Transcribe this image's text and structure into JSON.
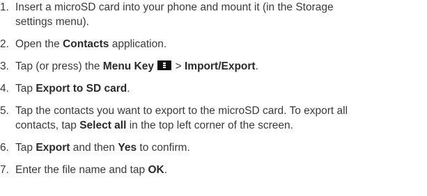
{
  "steps": [
    {
      "num": "1.",
      "line1": "Insert a microSD card into your phone and mount it (in the Storage",
      "line2": "settings menu)."
    },
    {
      "num": "2.",
      "pre": "Open the ",
      "bold": "Contacts",
      "post": " application."
    },
    {
      "num": "3.",
      "pre": "Tap (or press) the ",
      "bold1": "Menu Key",
      "icon": "menu-key-icon",
      "mid": " > ",
      "bold2": "Import/Export",
      "post": "."
    },
    {
      "num": "4.",
      "pre": "Tap ",
      "bold": "Export to SD card",
      "post": "."
    },
    {
      "num": "5.",
      "line1": "Tap the contacts you want to export to the microSD card. To export all",
      "line2_pre": "contacts, tap ",
      "line2_bold": "Select all",
      "line2_post": " in the top left corner of the screen."
    },
    {
      "num": "6.",
      "pre": "Tap ",
      "bold1": "Export",
      "mid": " and then ",
      "bold2": "Yes",
      "post": " to confirm."
    },
    {
      "num": "7.",
      "pre": "Enter the file name and tap ",
      "bold": "OK",
      "post": "."
    }
  ]
}
